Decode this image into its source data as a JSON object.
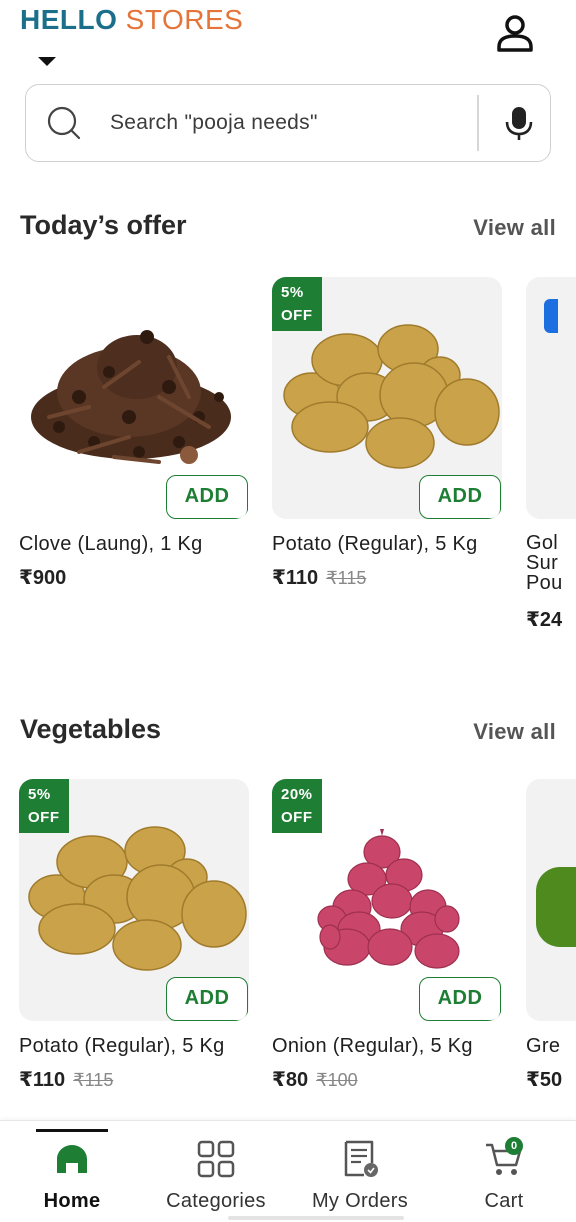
{
  "header": {
    "logo_part1": "HELLO",
    "logo_part2": "STORES",
    "icons": [
      "chevron-down-icon",
      "profile-icon"
    ]
  },
  "search": {
    "placeholder": "Search \"pooja needs\"",
    "icons": [
      "search-icon",
      "mic-icon"
    ]
  },
  "sections": [
    {
      "title": "Today’s offer",
      "view_all": "View all",
      "products": [
        {
          "name": "Clove (Laung), 1 Kg",
          "price": "₹900",
          "mrp": "",
          "discount": "",
          "add_label": "ADD"
        },
        {
          "name": "Potato (Regular), 5 Kg",
          "price": "₹110",
          "mrp": "₹115",
          "discount_pct": "5%",
          "discount_off": "OFF",
          "add_label": "ADD"
        },
        {
          "name_line1": "Gol",
          "name_line2": "Sur",
          "name_line3": "Pou",
          "price": "₹24"
        }
      ]
    },
    {
      "title": "Vegetables",
      "view_all": "View all",
      "products": [
        {
          "name": "Potato (Regular), 5 Kg",
          "price": "₹110",
          "mrp": "₹115",
          "discount_pct": "5%",
          "discount_off": "OFF",
          "add_label": "ADD"
        },
        {
          "name": "Onion (Regular), 5 Kg",
          "price": "₹80",
          "mrp": "₹100",
          "discount_pct": "20%",
          "discount_off": "OFF",
          "add_label": "ADD"
        },
        {
          "name": "Gre",
          "price": "₹50"
        }
      ]
    }
  ],
  "bottom_nav": {
    "items": [
      {
        "label": "Home",
        "icon": "home-icon",
        "active": true
      },
      {
        "label": "Categories",
        "icon": "grid-icon",
        "active": false
      },
      {
        "label": "My Orders",
        "icon": "orders-icon",
        "active": false
      },
      {
        "label": "Cart",
        "icon": "cart-icon",
        "active": false
      }
    ],
    "cart_count": "0"
  },
  "colors": {
    "brand_primary": "#1b6f8a",
    "brand_secondary": "#e5743a",
    "accent_green": "#1e7e34"
  }
}
